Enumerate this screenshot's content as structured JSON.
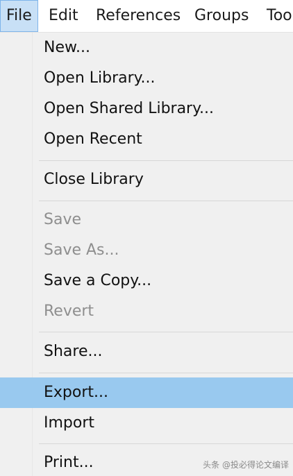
{
  "menubar": {
    "items": [
      {
        "label": "File",
        "active": true
      },
      {
        "label": "Edit"
      },
      {
        "label": "References"
      },
      {
        "label": "Groups"
      },
      {
        "label": "Too"
      }
    ]
  },
  "file_menu": {
    "items": [
      {
        "label": "New...",
        "enabled": true
      },
      {
        "label": "Open Library...",
        "enabled": true
      },
      {
        "label": "Open Shared Library...",
        "enabled": true
      },
      {
        "label": "Open Recent",
        "enabled": true
      },
      {
        "label": "Close Library",
        "enabled": true
      },
      {
        "label": "Save",
        "enabled": false
      },
      {
        "label": "Save As...",
        "enabled": false
      },
      {
        "label": "Save a Copy...",
        "enabled": true
      },
      {
        "label": "Revert",
        "enabled": false
      },
      {
        "label": "Share...",
        "enabled": true
      },
      {
        "label": "Export...",
        "enabled": true,
        "highlighted": true
      },
      {
        "label": "Import",
        "enabled": true
      },
      {
        "label": "Print...",
        "enabled": true
      }
    ]
  },
  "watermark": "头条 @投必得论文编译"
}
